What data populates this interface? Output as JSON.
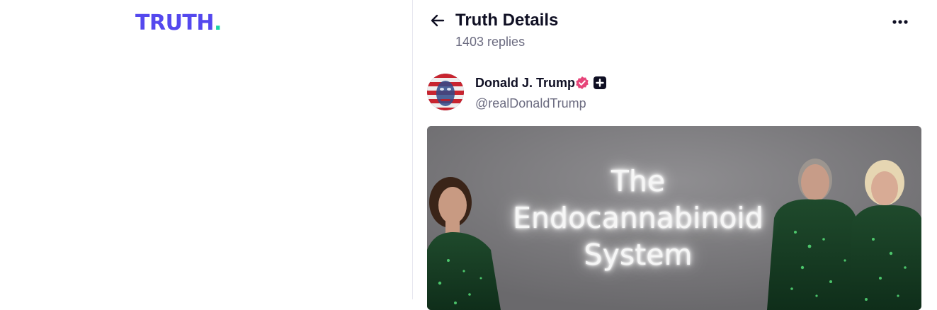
{
  "sidebar": {
    "logo": {
      "text": "TRUTH",
      "dot": "."
    }
  },
  "header": {
    "title": "Truth Details",
    "subtitle": "1403 replies"
  },
  "post": {
    "author": {
      "name": "Donald J. Trump",
      "handle": "@realDonaldTrump",
      "verified_icon": "verified-badge-icon",
      "plus_icon": "plus-badge-icon"
    },
    "media": {
      "overlay_lines": [
        "The",
        "Endocannabinoid",
        "System"
      ]
    }
  },
  "colors": {
    "brand_purple": "#5448ee",
    "brand_green": "#1bd5a8",
    "verified_pink": "#e7457a",
    "text_primary": "#0f0f23",
    "text_secondary": "#6b6b80"
  }
}
